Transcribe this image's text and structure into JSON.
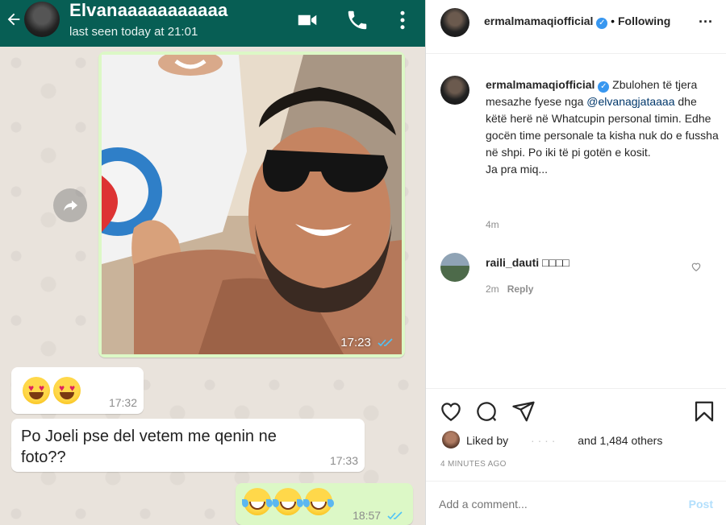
{
  "whatsapp": {
    "contact_name": "Elvanaaaaaaaaaaa",
    "last_seen": "last seen today at 21:01",
    "icons": [
      "back-arrow-icon",
      "video-call-icon",
      "phone-icon",
      "more-vert-icon",
      "forward-icon"
    ],
    "messages": [
      {
        "type": "image",
        "direction": "outgoing",
        "time": "17:23",
        "read": true
      },
      {
        "type": "emoji",
        "direction": "incoming",
        "emoji": "heart-eyes",
        "count": 2,
        "time": "17:32"
      },
      {
        "type": "text",
        "direction": "incoming",
        "text": "Po Joeli pse del vetem me qenin ne foto??",
        "time": "17:33"
      },
      {
        "type": "emoji",
        "direction": "outgoing",
        "emoji": "tears-of-joy",
        "count": 3,
        "time": "18:57",
        "read": true
      }
    ],
    "colors": {
      "header": "#075e54",
      "outgoing": "#dcf8c6",
      "incoming": "#ffffff",
      "read_ticks": "#4fc3f7"
    }
  },
  "instagram": {
    "header": {
      "username": "ermalmamaqiofficial",
      "separator": "•",
      "follow_status": "Following",
      "more": "..."
    },
    "caption": {
      "username": "ermalmamaqiofficial",
      "text_before": "Zbulohen të tjera mesazhe fyese nga",
      "mention": "@elvanagjataaaa",
      "text_after": "dhe këtë herë në Whatcupin personal timin. Edhe gocën time personale ta kisha nuk do e fussha në shpi. Po iki të pi gotën e kosit.",
      "closing": "Ja pra miq...",
      "age": "4m"
    },
    "comments": [
      {
        "username": "raili_dauti",
        "text": "□□□□",
        "age": "2m",
        "reply_label": "Reply"
      }
    ],
    "actions": {
      "icons": [
        "heart-icon",
        "comment-icon",
        "share-icon",
        "bookmark-icon"
      ]
    },
    "likes": {
      "prefix": "Liked by",
      "blurred_user": "·  ·  ·  ·",
      "suffix": "and 1,484 others"
    },
    "timestamp": "4 MINUTES AGO",
    "comment_input": {
      "placeholder": "Add a comment...",
      "post_label": "Post"
    },
    "colors": {
      "verified": "#3897f0",
      "mention": "#00376b",
      "muted": "#8e8e8e",
      "post_disabled": "#b2dffc"
    }
  }
}
